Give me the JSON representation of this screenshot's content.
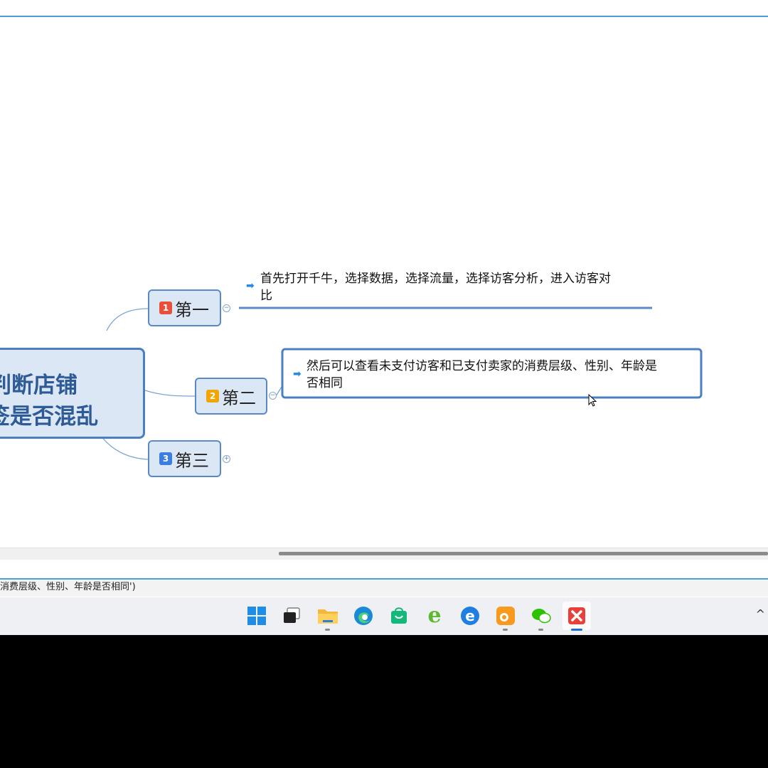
{
  "mindmap": {
    "central_topic": {
      "line1": "判断店铺",
      "line2": "签是否混乱"
    },
    "topics": [
      {
        "badge": "1",
        "label": "第一",
        "badge_color": "#e8503a",
        "collapse": "−",
        "subtopic_line1": "首先打开千牛，选择数据，选择流量，选择访客分析，进入访客对",
        "subtopic_line2": "比"
      },
      {
        "badge": "2",
        "label": "第二",
        "badge_color": "#f0a500",
        "collapse": "−",
        "subtopic_line1": "然后可以查看未支付访客和已支付卖家的消费层级、性别、年龄是",
        "subtopic_line2": "否相同"
      },
      {
        "badge": "3",
        "label": "第三",
        "badge_color": "#3b7de0",
        "collapse": "+"
      }
    ]
  },
  "status_bar": {
    "text": "消费层级、性别、年龄是否相同')"
  },
  "taskbar": {
    "icons": [
      "windows-start-icon",
      "task-view-icon",
      "file-explorer-icon",
      "edge-icon",
      "store-icon",
      "ie-browser-icon",
      "edge-legacy-icon",
      "uc-browser-icon",
      "wechat-icon",
      "xmind-icon"
    ],
    "tray_chevron": "^"
  },
  "colors": {
    "accent": "#4a9fd8",
    "topic_border": "#5a8ac6",
    "topic_fill": "#dce7f5",
    "central_text": "#2e5a96"
  }
}
